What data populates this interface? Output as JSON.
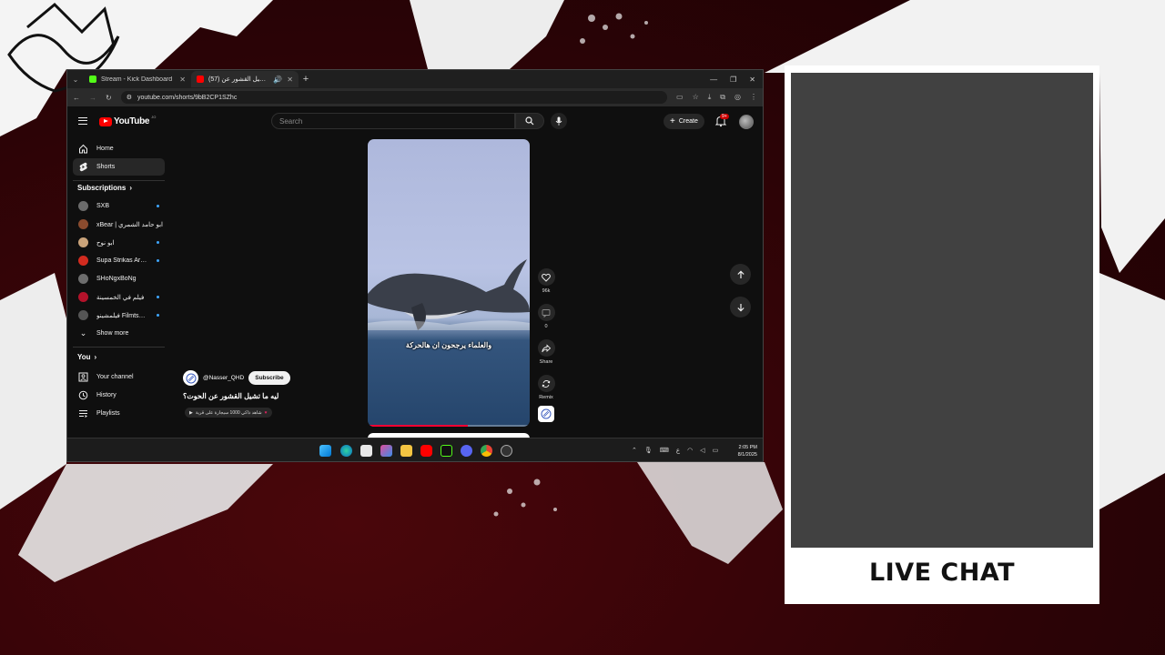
{
  "browser": {
    "tabs": [
      {
        "title": "Stream - Kick Dashboard",
        "favicon_color": "#53fc18",
        "active": false
      },
      {
        "title": "(57) ليه ما تشيل القشور عن",
        "favicon_color": "#ff0000",
        "active": true
      }
    ],
    "url": "youtube.com/shorts/9bB2CP1SZhc"
  },
  "youtube": {
    "logo": "YouTube",
    "logo_sup": "JO",
    "search_placeholder": "Search",
    "create_label": "Create",
    "notification_count": "9+",
    "sidebar": {
      "main": [
        {
          "label": "Home",
          "icon": "home-icon"
        },
        {
          "label": "Shorts",
          "icon": "shorts-icon",
          "active": true
        }
      ],
      "subscriptions_heading": "Subscriptions",
      "subscriptions": [
        {
          "name": "SXB",
          "color": "#6b6b6b",
          "dot": true
        },
        {
          "name": "xBear | ابو حامد الشمري",
          "color": "#8a4b2e",
          "dot": false
        },
        {
          "name": "ابو نوح",
          "color": "#c9a37a",
          "dot": true
        },
        {
          "name": "Supa Strikas Ara...",
          "color": "#d22b1f",
          "dot": true
        },
        {
          "name": "SHoNgxBoNg",
          "color": "#6d6d6d",
          "dot": false
        },
        {
          "name": "فيلم في الخمسينة",
          "color": "#b3122a",
          "dot": true
        },
        {
          "name": "فيلمشينو Filmtshino",
          "color": "#555555",
          "dot": true
        }
      ],
      "show_more": "Show more",
      "you_heading": "You",
      "you_items": [
        {
          "label": "Your channel",
          "icon": "channel-icon"
        },
        {
          "label": "History",
          "icon": "history-icon"
        },
        {
          "label": "Playlists",
          "icon": "playlists-icon"
        }
      ]
    },
    "short": {
      "caption": "والعلماء يرجحون ان هالحركة",
      "channel": "@Nasser_QHD",
      "subscribe_label": "Subscribe",
      "title": "ليه ما تشيل القشور عن الحوت؟",
      "sub_text": "شاهد ذاكي 1000 سيجارة على قرية",
      "progress": 0.62,
      "likes": "96k",
      "comments": "0",
      "share_label": "Share",
      "remix_label": "Remix"
    }
  },
  "taskbar": {
    "time": "2:05 PM",
    "date": "8/1/2025",
    "lang": "ع"
  },
  "overlay": {
    "live_chat_label": "LIVE CHAT"
  }
}
